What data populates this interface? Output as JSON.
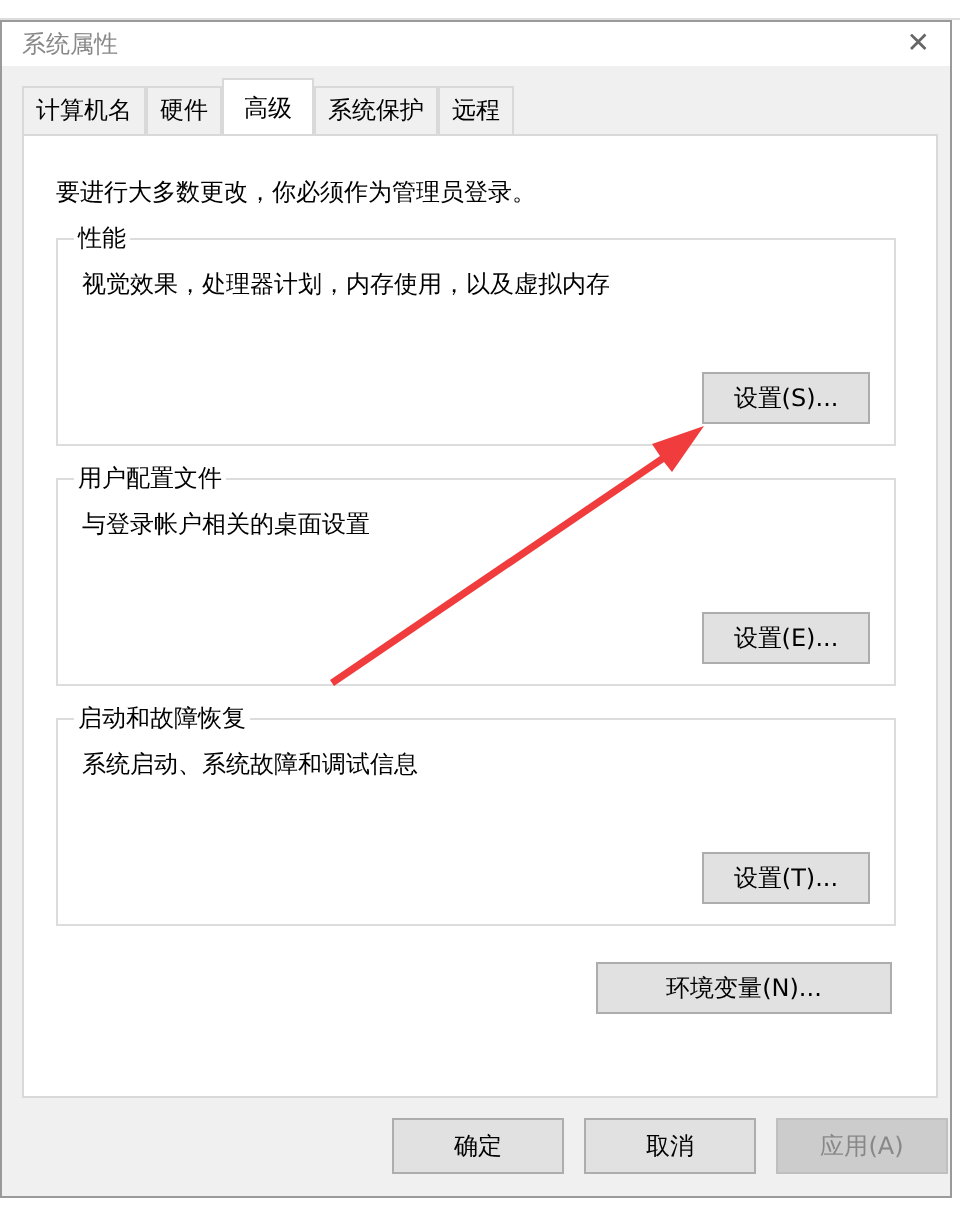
{
  "window": {
    "title": "系统属性",
    "close": "✕"
  },
  "tabs": [
    {
      "label": "计算机名",
      "selected": false
    },
    {
      "label": "硬件",
      "selected": false
    },
    {
      "label": "高级",
      "selected": true
    },
    {
      "label": "系统保护",
      "selected": false
    },
    {
      "label": "远程",
      "selected": false
    }
  ],
  "notice": "要进行大多数更改，你必须作为管理员登录。",
  "groups": [
    {
      "title": "性能",
      "description": "视觉效果，处理器计划，内存使用，以及虚拟内存",
      "button": "设置(S)..."
    },
    {
      "title": "用户配置文件",
      "description": "与登录帐户相关的桌面设置",
      "button": "设置(E)..."
    },
    {
      "title": "启动和故障恢复",
      "description": "系统启动、系统故障和调试信息",
      "button": "设置(T)..."
    }
  ],
  "env_button": "环境变量(N)...",
  "buttons": [
    {
      "label": "确定",
      "disabled": false
    },
    {
      "label": "取消",
      "disabled": false
    },
    {
      "label": "应用(A)",
      "disabled": true
    }
  ]
}
